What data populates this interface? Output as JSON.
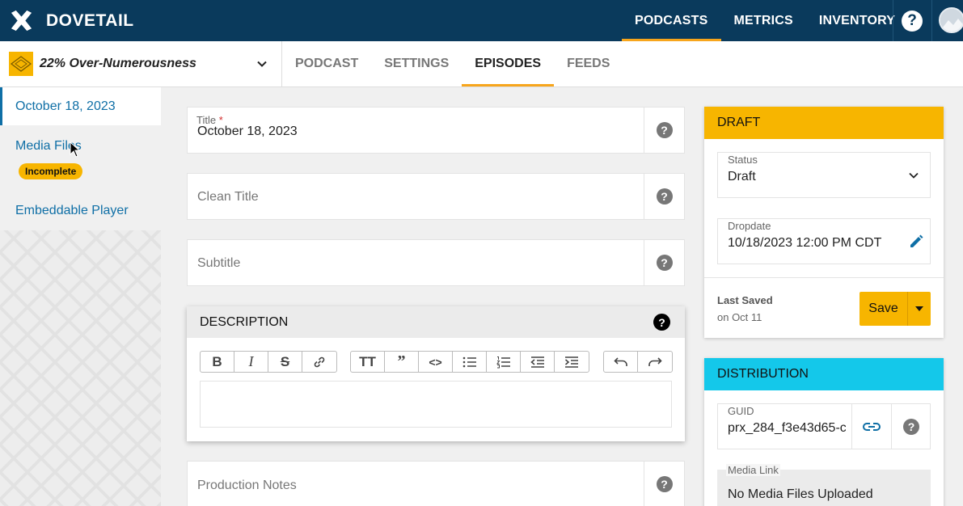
{
  "app": {
    "brand": "DOVETAIL"
  },
  "nav": {
    "links": [
      {
        "label": "PODCASTS",
        "active": true
      },
      {
        "label": "METRICS",
        "active": false
      },
      {
        "label": "INVENTORY",
        "active": false
      }
    ],
    "help_label": "?"
  },
  "podcast": {
    "name": "22% Over-Numerousness"
  },
  "tabs": [
    {
      "label": "PODCAST"
    },
    {
      "label": "SETTINGS"
    },
    {
      "label": "EPISODES",
      "active": true
    },
    {
      "label": "FEEDS"
    }
  ],
  "sidebar": {
    "items": [
      {
        "label": "October 18, 2023",
        "active": true
      },
      {
        "label": "Media Files",
        "badge": "Incomplete"
      },
      {
        "label": "Embeddable Player"
      }
    ]
  },
  "form": {
    "title": {
      "label": "Title",
      "required_mark": "*",
      "value": "October 18, 2023"
    },
    "clean_title": {
      "placeholder": "Clean Title"
    },
    "subtitle": {
      "placeholder": "Subtitle"
    },
    "description": {
      "header": "DESCRIPTION"
    },
    "production_notes": {
      "placeholder": "Production Notes"
    }
  },
  "draft_panel": {
    "header": "DRAFT",
    "header_color": "#f7b500",
    "status": {
      "label": "Status",
      "value": "Draft"
    },
    "dropdate": {
      "label": "Dropdate",
      "value": "10/18/2023 12:00 PM CDT"
    },
    "last_saved": {
      "label": "Last Saved",
      "value": "on Oct 11"
    },
    "save_label": "Save"
  },
  "distribution_panel": {
    "header": "DISTRIBUTION",
    "header_color": "#14c8ea",
    "guid": {
      "label": "GUID",
      "value": "prx_284_f3e43d65-c"
    },
    "media_link": {
      "label": "Media Link",
      "value": "No Media Files Uploaded"
    }
  },
  "colors": {
    "navbar": "#0a3a5c",
    "accent": "#f7a51c",
    "link": "#0f6fa6"
  }
}
